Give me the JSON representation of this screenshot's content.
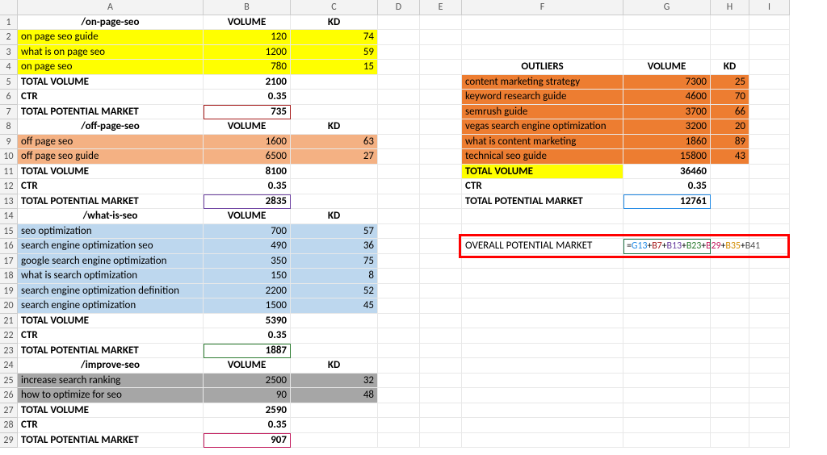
{
  "columns": [
    "A",
    "B",
    "C",
    "D",
    "E",
    "F",
    "G",
    "H",
    "I"
  ],
  "rows": 29,
  "sections": {
    "onpage": {
      "header_a": "/on-page-seo",
      "header_b": "VOLUME",
      "header_c": "KD",
      "items": [
        {
          "kw": "on page seo guide",
          "vol": 120,
          "kd": 74
        },
        {
          "kw": "what is on page seo",
          "vol": 1200,
          "kd": 59
        },
        {
          "kw": "on page seo",
          "vol": 780,
          "kd": 15
        }
      ],
      "total_label": "TOTAL VOLUME",
      "total": 2100,
      "ctr_label": "CTR",
      "ctr": "0.35",
      "pot_label": "TOTAL POTENTIAL MARKET",
      "pot": 735
    },
    "offpage": {
      "header_a": "/off-page-seo",
      "header_b": "VOLUME",
      "header_c": "KD",
      "items": [
        {
          "kw": "off page seo",
          "vol": 1600,
          "kd": 63
        },
        {
          "kw": "off page seo guide",
          "vol": 6500,
          "kd": 27
        }
      ],
      "total_label": "TOTAL VOLUME",
      "total": 8100,
      "ctr_label": "CTR",
      "ctr": "0.35",
      "pot_label": "TOTAL POTENTIAL MARKET",
      "pot": 2835
    },
    "whatis": {
      "header_a": "/what-is-seo",
      "header_b": "VOLUME",
      "header_c": "KD",
      "items": [
        {
          "kw": "seo optimization",
          "vol": 700,
          "kd": 57
        },
        {
          "kw": "search engine optimization seo",
          "vol": 490,
          "kd": 36
        },
        {
          "kw": "google search engine optimization",
          "vol": 350,
          "kd": 75
        },
        {
          "kw": "what is search optimization",
          "vol": 150,
          "kd": 8
        },
        {
          "kw": "search engine optimization definition",
          "vol": 2200,
          "kd": 52
        },
        {
          "kw": "search engine optimization",
          "vol": 1500,
          "kd": 45
        }
      ],
      "total_label": "TOTAL VOLUME",
      "total": 5390,
      "ctr_label": "CTR",
      "ctr": "0.35",
      "pot_label": "TOTAL POTENTIAL MARKET",
      "pot": 1887
    },
    "improve": {
      "header_a": "/improve-seo",
      "header_b": "VOLUME",
      "header_c": "KD",
      "items": [
        {
          "kw": "increase search ranking",
          "vol": 2500,
          "kd": 32
        },
        {
          "kw": "how to optimize for seo",
          "vol": 90,
          "kd": 48
        }
      ],
      "total_label": "TOTAL VOLUME",
      "total": 2590,
      "ctr_label": "CTR",
      "ctr": "0.35",
      "pot_label": "TOTAL POTENTIAL MARKET",
      "pot": 907
    }
  },
  "outliers": {
    "title": "OUTLIERS",
    "vol_header": "VOLUME",
    "kd_header": "KD",
    "items": [
      {
        "kw": "content marketing strategy",
        "vol": 7300,
        "kd": 25
      },
      {
        "kw": "keyword research guide",
        "vol": 4600,
        "kd": 70
      },
      {
        "kw": "semrush guide",
        "vol": 3700,
        "kd": 66
      },
      {
        "kw": "vegas search engine optimization",
        "vol": 3200,
        "kd": 20
      },
      {
        "kw": "what is content marketing",
        "vol": 1860,
        "kd": 89
      },
      {
        "kw": "technical seo guide",
        "vol": 15800,
        "kd": 43
      }
    ],
    "total_label": "TOTAL VOLUME",
    "total": 36460,
    "ctr_label": "CTR",
    "ctr": "0.35",
    "pot_label": "TOTAL POTENTIAL MARKET",
    "pot": 12761
  },
  "overall": {
    "label": "OVERALL POTENTIAL MARKET",
    "formula_parts": {
      "eq": "=",
      "g13": "G13",
      "p": "+",
      "b7": "B7",
      "b13": "B13",
      "b23": "B23",
      "b29": "B29",
      "b35": "B35",
      "b41": "B41"
    }
  }
}
